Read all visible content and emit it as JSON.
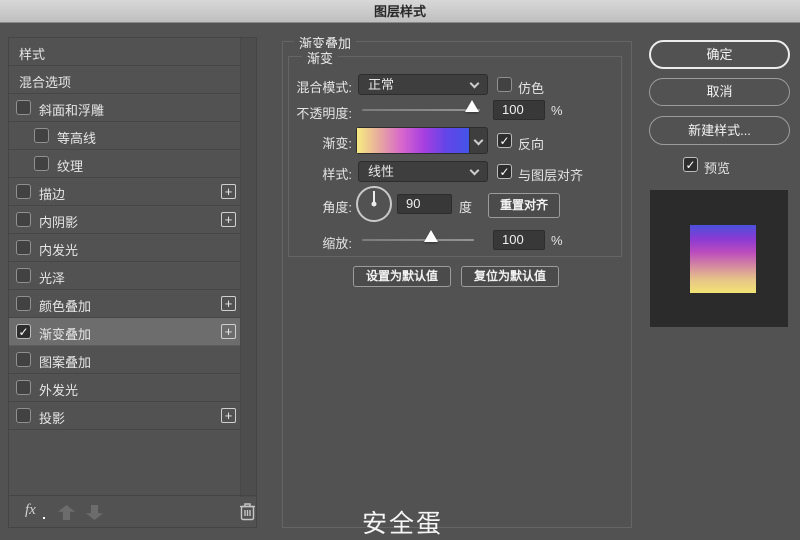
{
  "window": {
    "title": "图层样式"
  },
  "sidebar": {
    "items": [
      {
        "label": "样式",
        "type": "plain",
        "checked": false,
        "plus": false,
        "indent": false,
        "selected": false
      },
      {
        "label": "混合选项",
        "type": "plain",
        "checked": false,
        "plus": false,
        "indent": false,
        "selected": false
      },
      {
        "label": "斜面和浮雕",
        "type": "check",
        "checked": false,
        "plus": false,
        "indent": false,
        "selected": false
      },
      {
        "label": "等高线",
        "type": "check",
        "checked": false,
        "plus": false,
        "indent": true,
        "selected": false
      },
      {
        "label": "纹理",
        "type": "check",
        "checked": false,
        "plus": false,
        "indent": true,
        "selected": false
      },
      {
        "label": "描边",
        "type": "check",
        "checked": false,
        "plus": true,
        "indent": false,
        "selected": false
      },
      {
        "label": "内阴影",
        "type": "check",
        "checked": false,
        "plus": true,
        "indent": false,
        "selected": false
      },
      {
        "label": "内发光",
        "type": "check",
        "checked": false,
        "plus": false,
        "indent": false,
        "selected": false
      },
      {
        "label": "光泽",
        "type": "check",
        "checked": false,
        "plus": false,
        "indent": false,
        "selected": false
      },
      {
        "label": "颜色叠加",
        "type": "check",
        "checked": false,
        "plus": true,
        "indent": false,
        "selected": false
      },
      {
        "label": "渐变叠加",
        "type": "check",
        "checked": true,
        "plus": true,
        "indent": false,
        "selected": true
      },
      {
        "label": "图案叠加",
        "type": "check",
        "checked": false,
        "plus": false,
        "indent": false,
        "selected": false
      },
      {
        "label": "外发光",
        "type": "check",
        "checked": false,
        "plus": false,
        "indent": false,
        "selected": false
      },
      {
        "label": "投影",
        "type": "check",
        "checked": false,
        "plus": true,
        "indent": false,
        "selected": false
      }
    ],
    "footer": {
      "fx_label": "fx",
      "icons": [
        "fx-icon",
        "move-up-icon",
        "move-down-icon",
        "trash-icon"
      ]
    }
  },
  "main": {
    "section_title": "渐变叠加",
    "group_title": "渐变",
    "blend_mode": {
      "label": "混合模式:",
      "value": "正常"
    },
    "dither": {
      "label": "仿色",
      "checked": false
    },
    "opacity": {
      "label": "不透明度:",
      "value": "100",
      "unit": "%",
      "slider_pos": 0.95
    },
    "gradient": {
      "label": "渐变:",
      "stops": [
        "#f6ec80",
        "#e7a99e",
        "#d766cc",
        "#a63fe2",
        "#6245e8",
        "#4454e8"
      ]
    },
    "reverse": {
      "label": "反向",
      "checked": true
    },
    "style": {
      "label": "样式:",
      "value": "线性"
    },
    "align_layer": {
      "label": "与图层对齐",
      "checked": true
    },
    "angle": {
      "label": "角度:",
      "value": "90",
      "unit": "度",
      "reset_button": "重置对齐"
    },
    "scale": {
      "label": "缩放:",
      "value": "100",
      "unit": "%",
      "slider_pos": 0.58
    },
    "set_default_button": "设置为默认值",
    "reset_default_button": "复位为默认值"
  },
  "actions": {
    "ok": "确定",
    "cancel": "取消",
    "new_style": "新建样式...",
    "preview": {
      "label": "预览",
      "checked": true
    }
  },
  "preview_thumb": {
    "stops": [
      "#4a51dc",
      "#8a3ad4",
      "#bb4cbe",
      "#d488a0",
      "#e6c488",
      "#f2e474"
    ],
    "well_color": "#2b2b2b"
  },
  "watermark": "安全蛋",
  "colors": {
    "dialog_bg": "#525252",
    "panel_border": "#454545",
    "highlight_row": "#6d6d6d",
    "control_bg": "#3e3e3e",
    "text": "#e6e6e6"
  }
}
